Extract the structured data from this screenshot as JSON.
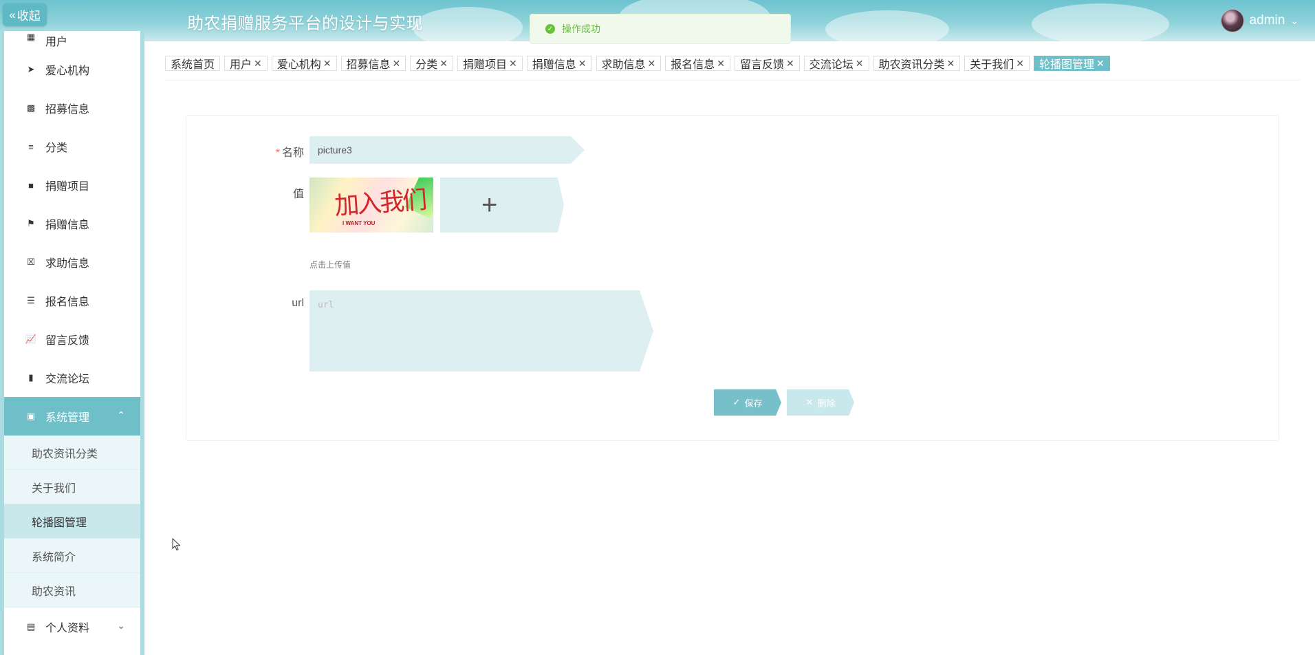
{
  "header": {
    "collapse_label": "收起",
    "title": "助农捐赠服务平台的设计与实现",
    "user_name": "admin"
  },
  "toast": {
    "message": "操作成功"
  },
  "sidebar": {
    "items": [
      {
        "label": "用户",
        "icon": "grid-icon"
      },
      {
        "label": "爱心机构",
        "icon": "send-icon"
      },
      {
        "label": "招募信息",
        "icon": "printer-icon"
      },
      {
        "label": "分类",
        "icon": "sliders-icon"
      },
      {
        "label": "捐赠项目",
        "icon": "brush-icon"
      },
      {
        "label": "捐赠信息",
        "icon": "flag-icon"
      },
      {
        "label": "求助信息",
        "icon": "clipboard-x-icon"
      },
      {
        "label": "报名信息",
        "icon": "list-icon"
      },
      {
        "label": "留言反馈",
        "icon": "chart-line-icon"
      },
      {
        "label": "交流论坛",
        "icon": "bar-chart-icon"
      }
    ],
    "system": {
      "label": "系统管理",
      "submenu": [
        "助农资讯分类",
        "关于我们",
        "轮播图管理",
        "系统简介",
        "助农资讯"
      ]
    },
    "profile_label": "个人资料"
  },
  "tabs": [
    {
      "label": "系统首页",
      "closable": false
    },
    {
      "label": "用户",
      "closable": true
    },
    {
      "label": "爱心机构",
      "closable": true
    },
    {
      "label": "招募信息",
      "closable": true
    },
    {
      "label": "分类",
      "closable": true
    },
    {
      "label": "捐赠项目",
      "closable": true
    },
    {
      "label": "捐赠信息",
      "closable": true
    },
    {
      "label": "求助信息",
      "closable": true
    },
    {
      "label": "报名信息",
      "closable": true
    },
    {
      "label": "留言反馈",
      "closable": true
    },
    {
      "label": "交流论坛",
      "closable": true
    },
    {
      "label": "助农资讯分类",
      "closable": true
    },
    {
      "label": "关于我们",
      "closable": true
    },
    {
      "label": "轮播图管理",
      "closable": true,
      "active": true
    }
  ],
  "form": {
    "name_label": "名称",
    "name_value": "picture3",
    "value_label": "值",
    "upload_hint": "点击上传值",
    "url_label": "url",
    "url_placeholder": "url",
    "image_text": "加入我们",
    "image_subtext": "I WANT YOU",
    "save_label": "保存",
    "delete_label": "删除"
  },
  "colors": {
    "accent": "#6fbfc9",
    "field_bg": "#ddeff1",
    "success": "#67c23a"
  }
}
